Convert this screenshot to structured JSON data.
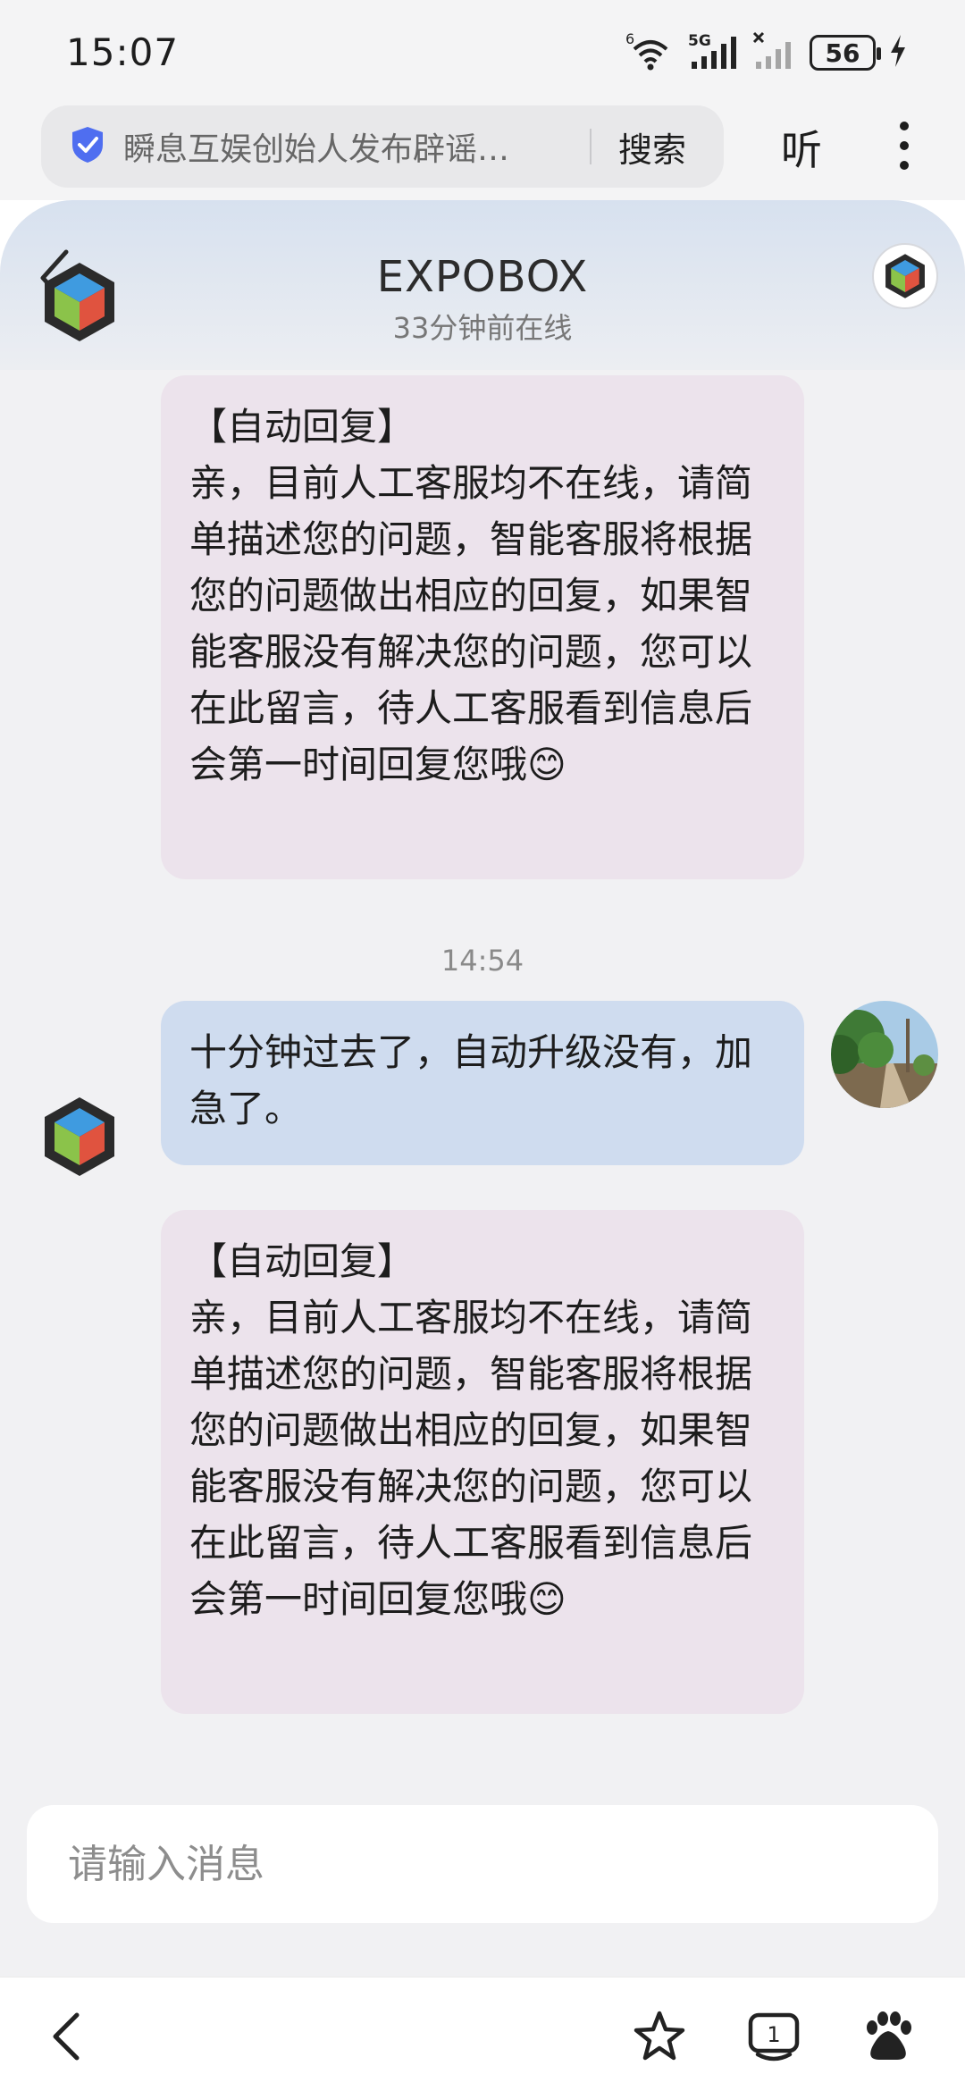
{
  "status_bar": {
    "time": "15:07",
    "network_labels": [
      "6",
      "5G"
    ],
    "battery_level": "56",
    "icons": [
      "wifi-icon",
      "signal-icon",
      "no-signal-icon",
      "battery-icon",
      "charging-icon"
    ]
  },
  "browser": {
    "search_text": "瞬息互娱创始人发布辟谣…",
    "search_button": "搜索",
    "listen_button": "听",
    "icons": [
      "shield-icon",
      "more-icon"
    ]
  },
  "chat": {
    "title": "EXPOBOX",
    "subtitle": "33分钟前在线",
    "messages": [
      {
        "sender": "bot",
        "text": "【自动回复】\n亲，目前人工客服均不在线，请简单描述您的问题，智能客服将根据您的问题做出相应的回复，如果智能客服没有解决您的问题，您可以在此留言，待人工客服看到信息后会第一时间回复您哦😊"
      },
      {
        "timestamp": "14:54"
      },
      {
        "sender": "user",
        "text": "十分钟过去了，自动升级没有，加急了。"
      },
      {
        "sender": "bot",
        "text": "【自动回复】\n亲，目前人工客服均不在线，请简单描述您的问题，智能客服将根据您的问题做出相应的回复，如果智能客服没有解决您的问题，您可以在此留言，待人工客服看到信息后会第一时间回复您哦😊"
      }
    ]
  },
  "input": {
    "placeholder": "请输入消息"
  },
  "bottom_nav": {
    "tab_count": "1",
    "icons": [
      "back-icon",
      "star-icon",
      "tabs-icon",
      "baidu-icon"
    ]
  }
}
